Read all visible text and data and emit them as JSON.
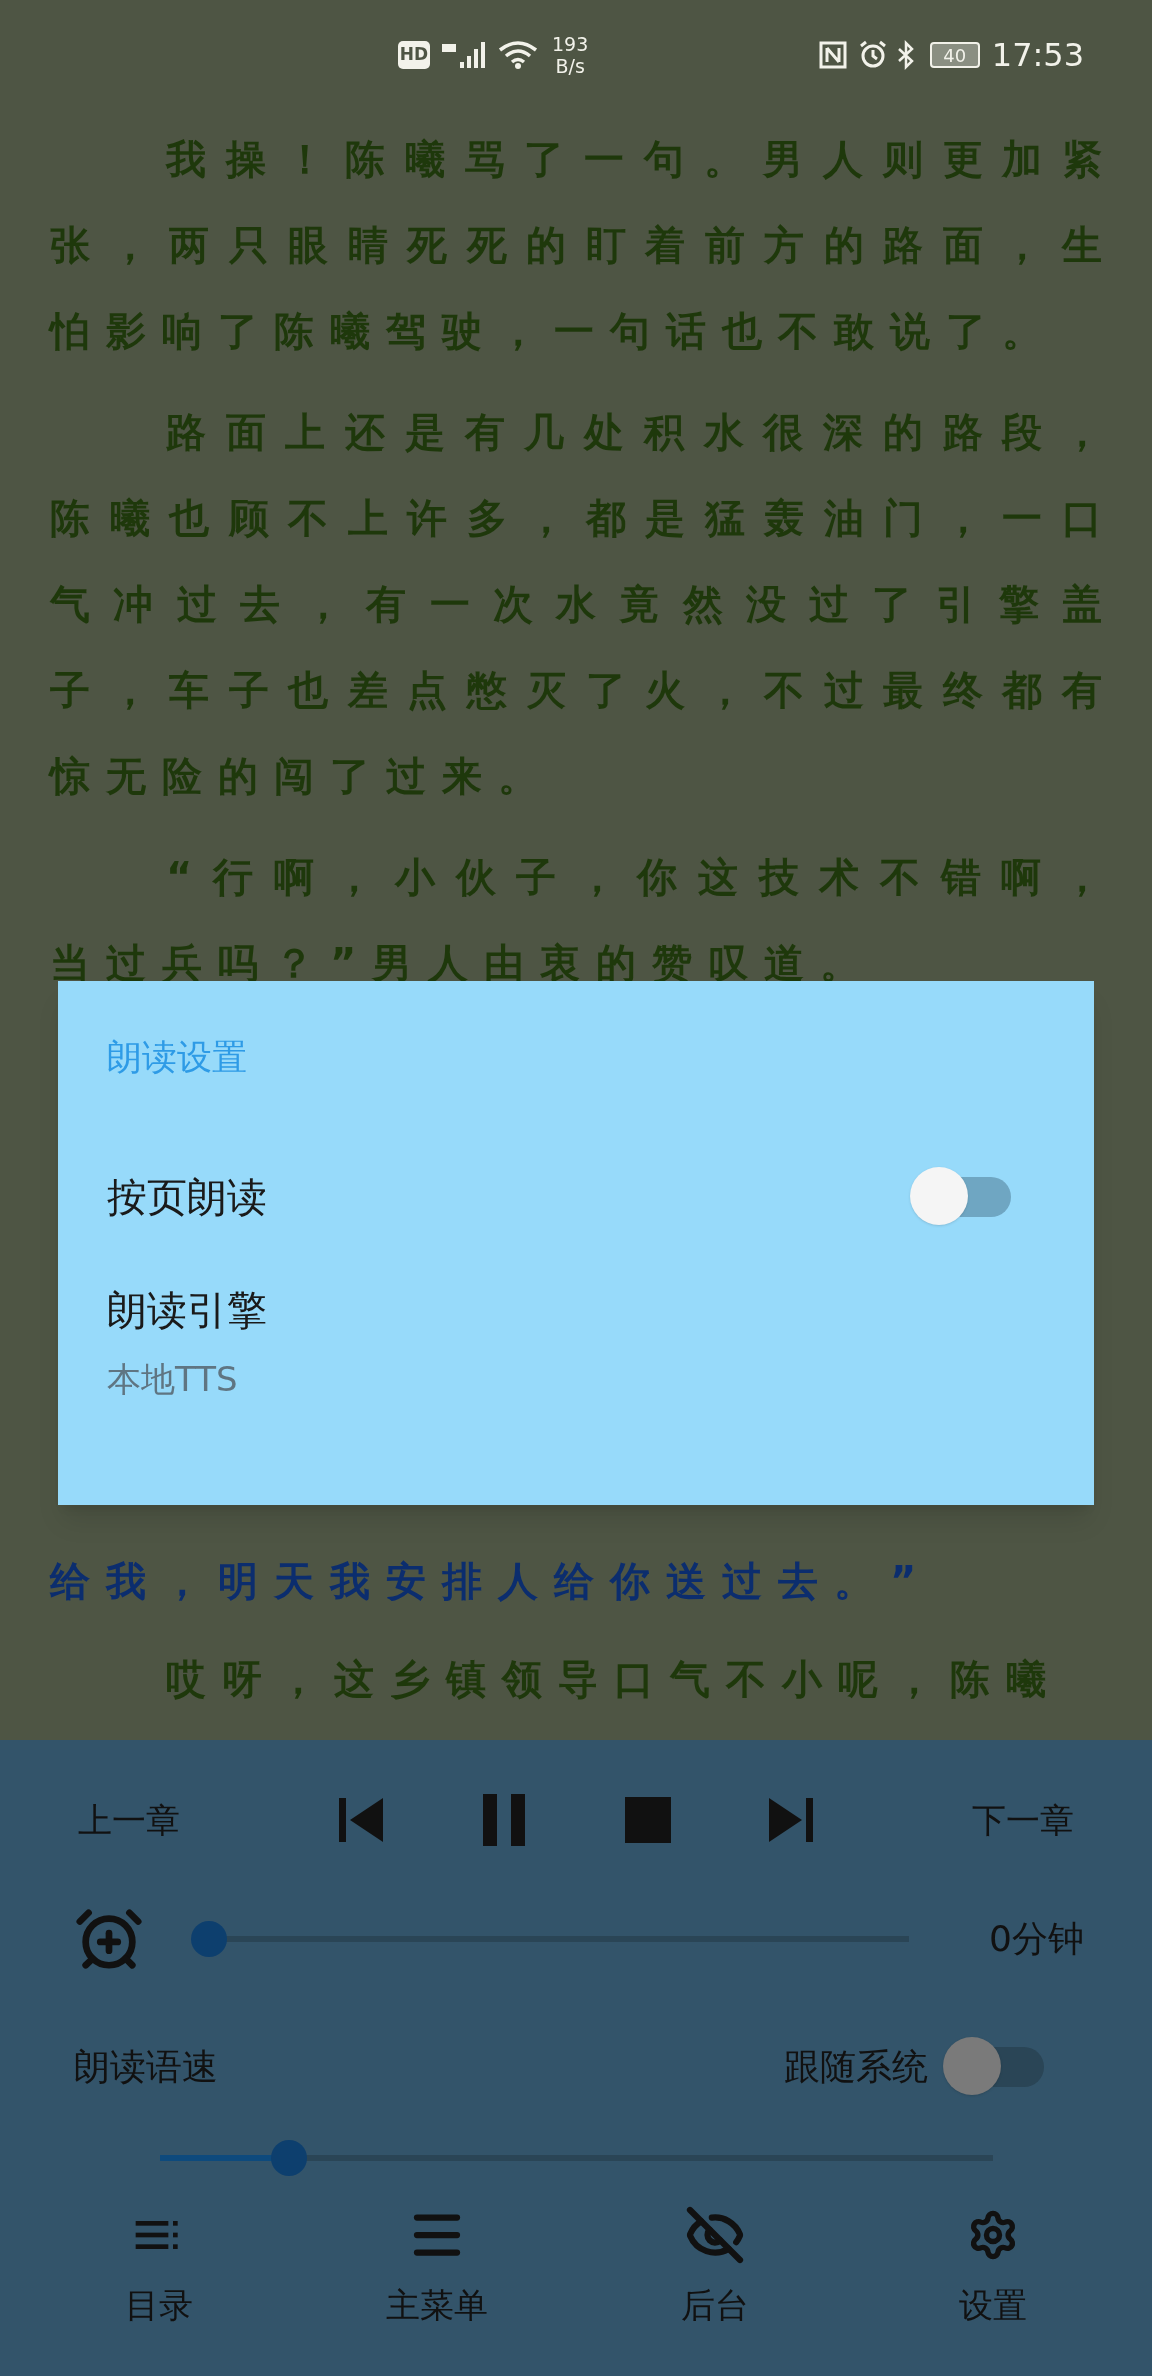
{
  "status_bar": {
    "hd_label": "HD",
    "net_speed": "193",
    "net_unit": "B/s",
    "battery": "40",
    "time": "17:53"
  },
  "before_dialog": [
    {
      "kind": "narration",
      "indent": true,
      "lines": [
        "我操！陈曦骂了一句。男人则更加紧",
        "张，两只眼睛死死的盯着前方的路面，生",
        "怕影响了陈曦驾驶，一句话也不敢说了。"
      ]
    },
    {
      "kind": "narration",
      "indent": true,
      "lines": [
        "路面上还是有几处积水很深的路段，",
        "陈曦也顾不上许多，都是猛轰油门，一口",
        "气冲过去，有一次水竟然没过了引擎盖",
        "子，车子也差点憋灭了火，不过最终都有",
        "惊无险的闯了过来。"
      ]
    },
    {
      "kind": "narration",
      "indent": true,
      "lines": [
        "“行啊，小伙子，你这技术不错啊，",
        "当过兵吗？”男人由衷的赞叹道。"
      ]
    }
  ],
  "after_dialog": [
    {
      "kind": "speech",
      "indent": false,
      "lines": [
        "给我，明天我安排人给你送过去。”"
      ]
    },
    {
      "kind": "narration",
      "indent": true,
      "lines": [
        "哎呀，这乡镇领导口气不小呢，陈曦"
      ]
    }
  ],
  "dialog": {
    "title": "朗读设置",
    "items": [
      {
        "kind": "switch",
        "label": "按页朗读",
        "on": false
      },
      {
        "kind": "choice",
        "label": "朗读引擎",
        "value": "本地TTS"
      }
    ]
  },
  "player": {
    "prev_chapter": "上一章",
    "next_chapter": "下一章",
    "playing": true
  },
  "timer": {
    "level": 0,
    "reading": "0分钟"
  },
  "speed": {
    "label": "朗读语速",
    "follow_label": "跟随系统",
    "follow_on": false,
    "level": 0.155
  },
  "nav": [
    {
      "kind": "toc",
      "label": "目录"
    },
    {
      "kind": "menu",
      "label": "主菜单"
    },
    {
      "kind": "hide",
      "label": "后台"
    },
    {
      "kind": "settings",
      "label": "设置"
    }
  ]
}
